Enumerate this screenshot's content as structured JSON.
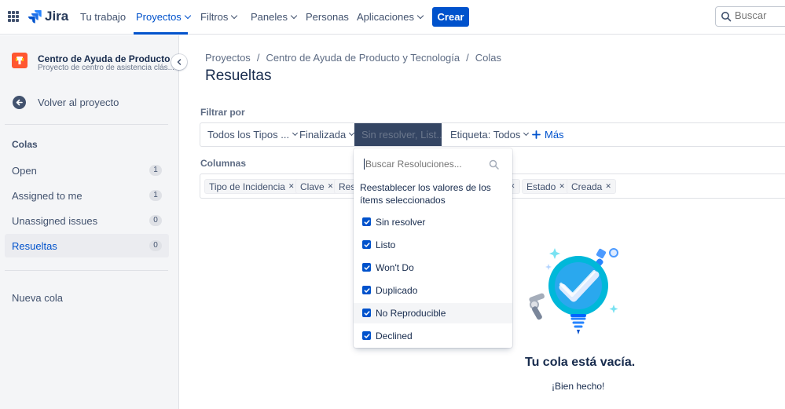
{
  "topnav": {
    "logo_text": "Jira",
    "items": [
      {
        "label": "Tu trabajo",
        "has_chevron": false,
        "active": false
      },
      {
        "label": "Proyectos",
        "has_chevron": true,
        "active": true
      },
      {
        "label": "Filtros",
        "has_chevron": true,
        "active": false
      },
      {
        "label": "Paneles",
        "has_chevron": true,
        "active": false
      },
      {
        "label": "Personas",
        "has_chevron": false,
        "active": false
      },
      {
        "label": "Aplicaciones",
        "has_chevron": true,
        "active": false
      }
    ],
    "create_label": "Crear",
    "search_placeholder": "Buscar"
  },
  "sidebar": {
    "project_name": "Centro de Ayuda de Producto ...",
    "project_subtitle": "Proyecto de centro de asistencia clás...",
    "back_label": "Volver al proyecto",
    "queues_heading": "Colas",
    "queues": [
      {
        "label": "Open",
        "count": "1",
        "active": false
      },
      {
        "label": "Assigned to me",
        "count": "1",
        "active": false
      },
      {
        "label": "Unassigned issues",
        "count": "0",
        "active": false
      },
      {
        "label": "Resueltas",
        "count": "0",
        "active": true
      }
    ],
    "new_queue_label": "Nueva cola"
  },
  "main": {
    "breadcrumb": [
      "Proyectos",
      "Centro de Ayuda de Producto y Tecnología",
      "Colas"
    ],
    "breadcrumb_separator": "/",
    "title": "Resueltas",
    "filter_label": "Filtrar por",
    "filters": [
      {
        "label": "Todos los Tipos ...",
        "selected": false
      },
      {
        "label": "Finalizada",
        "selected": false
      },
      {
        "label": "Sin resolver, List...",
        "selected": true
      },
      {
        "label": "Etiqueta: Todos",
        "selected": false
      }
    ],
    "more_label": "Más",
    "columns_label": "Columnas",
    "columns": [
      "Tipo de Incidencia",
      "Clave",
      "Resu",
      "Estado",
      "Creada"
    ]
  },
  "dropdown": {
    "search_placeholder": "Buscar Resoluciones...",
    "reset_text": "Reestablecer los valores de los ítems seleccionados",
    "options": [
      {
        "label": "Sin resolver",
        "checked": true
      },
      {
        "label": "Listo",
        "checked": true
      },
      {
        "label": "Won't Do",
        "checked": true
      },
      {
        "label": "Duplicado",
        "checked": true
      },
      {
        "label": "No Reproducible",
        "checked": true
      },
      {
        "label": "Declined",
        "checked": true
      }
    ]
  },
  "empty_state": {
    "title": "Tu cola está vacía.",
    "subtitle": "¡Bien hecho!"
  },
  "colors": {
    "primary": "#0052CC",
    "sidebar_bg": "#F4F5F7",
    "project_icon": "#FF5630",
    "selected_filter_bg": "#344563"
  }
}
